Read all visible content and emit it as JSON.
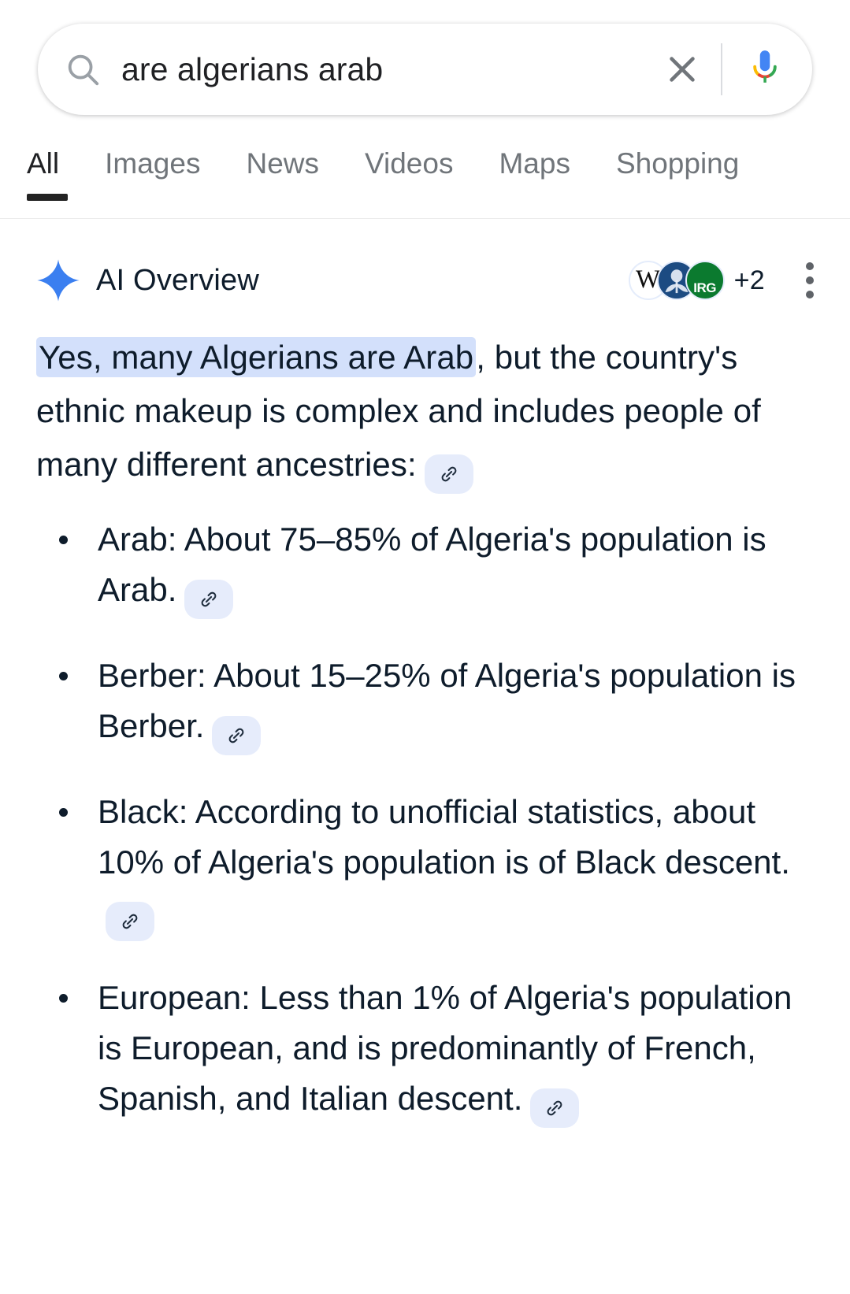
{
  "search": {
    "query": "are algerians arab",
    "placeholder": "Search",
    "search_icon": "search-icon",
    "clear_icon": "close-icon",
    "mic_icon": "microphone-icon"
  },
  "tabs": [
    {
      "label": "All",
      "active": true
    },
    {
      "label": "Images",
      "active": false
    },
    {
      "label": "News",
      "active": false
    },
    {
      "label": "Videos",
      "active": false
    },
    {
      "label": "Maps",
      "active": false
    },
    {
      "label": "Shopping",
      "active": false
    }
  ],
  "ai_overview": {
    "title": "AI Overview",
    "sparkle_icon": "ai-sparkle-icon",
    "kebab_icon": "more-options-icon",
    "sources": {
      "favicons": [
        {
          "name": "wikipedia-favicon",
          "glyph": "W"
        },
        {
          "name": "source-blue-favicon",
          "glyph": ""
        },
        {
          "name": "irg-favicon",
          "glyph": "IRG"
        }
      ],
      "extra_count": "+2"
    },
    "paragraph": {
      "highlight": "Yes, many Algerians are Arab",
      "rest": ", but the country's ethnic makeup is complex and includes people of many different ancestries:",
      "chip_icon": "link-icon"
    },
    "bullets": [
      {
        "text": "Arab: About 75–85% of Algeria's population is Arab.",
        "chip_icon": "link-icon"
      },
      {
        "text": "Berber: About 15–25% of Algeria's population is Berber.",
        "chip_icon": "link-icon"
      },
      {
        "text": "Black: According to unofficial statistics, about 10% of Algeria's population is of Black descent.",
        "chip_icon": "link-icon"
      },
      {
        "text": "European: Less than 1% of Algeria's population is European, and is predominantly of French, Spanish, and Italian descent.",
        "chip_icon": "link-icon"
      }
    ]
  },
  "colors": {
    "accent_blue": "#3b7ff0",
    "highlight_bg": "#d3e0fb",
    "chip_bg": "#e6ecfb",
    "text": "#0e1c2b",
    "tab_inactive": "#70757a"
  }
}
